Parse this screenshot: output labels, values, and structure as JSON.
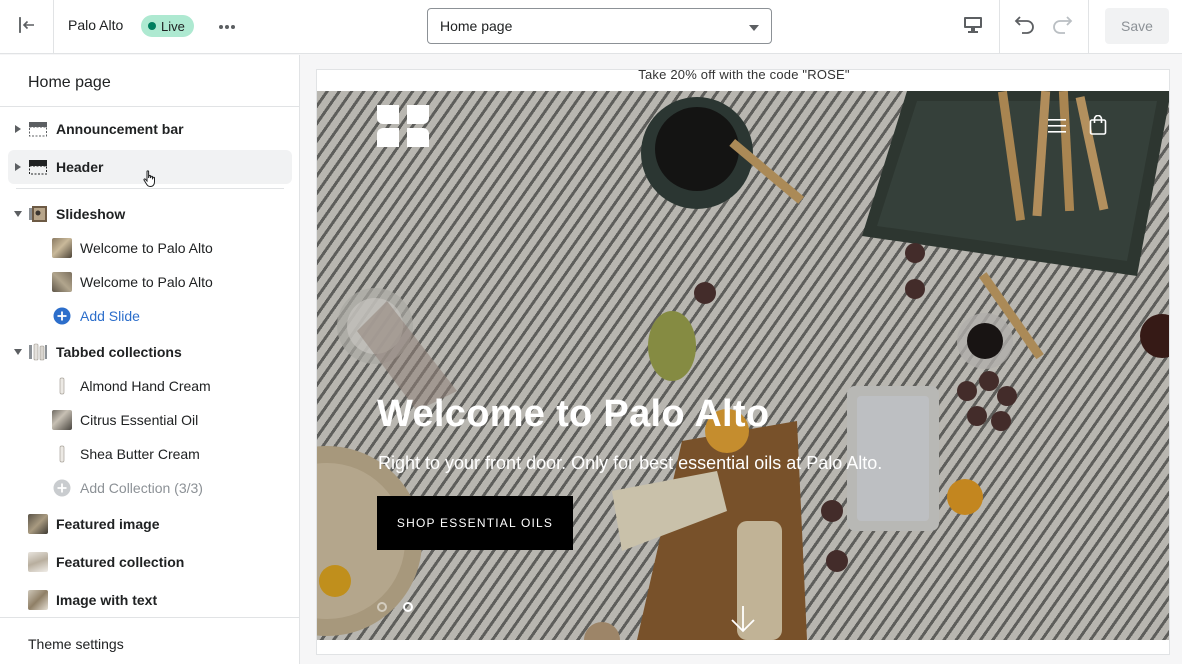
{
  "topbar": {
    "store_name": "Palo Alto",
    "live_label": "Live",
    "page_select_value": "Home page",
    "save_label": "Save"
  },
  "sidebar": {
    "title": "Home page",
    "sections": {
      "announcement": "Announcement bar",
      "header": "Header",
      "slideshow": {
        "label": "Slideshow",
        "slides": [
          "Welcome to Palo Alto",
          "Welcome to Palo Alto"
        ],
        "add_label": "Add Slide"
      },
      "tabbed": {
        "label": "Tabbed collections",
        "items": [
          "Almond Hand Cream",
          "Citrus Essential Oil",
          "Shea Butter Cream"
        ],
        "add_label": "Add Collection (3/3)"
      },
      "featured_image": "Featured image",
      "featured_collection": "Featured collection",
      "image_with_text": "Image with text"
    },
    "theme_settings": "Theme settings"
  },
  "preview": {
    "announcement": "Take 20% off with the code \"ROSE\"",
    "hero": {
      "title": "Welcome to Palo Alto",
      "subtitle": "Right to your front door. Only for best essential oils at Palo Alto.",
      "button_label": "SHOP ESSENTIAL OILS"
    }
  },
  "colors": {
    "live_badge_bg": "#aee9d1",
    "live_dot": "#007f5f",
    "link_blue": "#2c6ecb",
    "hero_button": "#000000"
  }
}
